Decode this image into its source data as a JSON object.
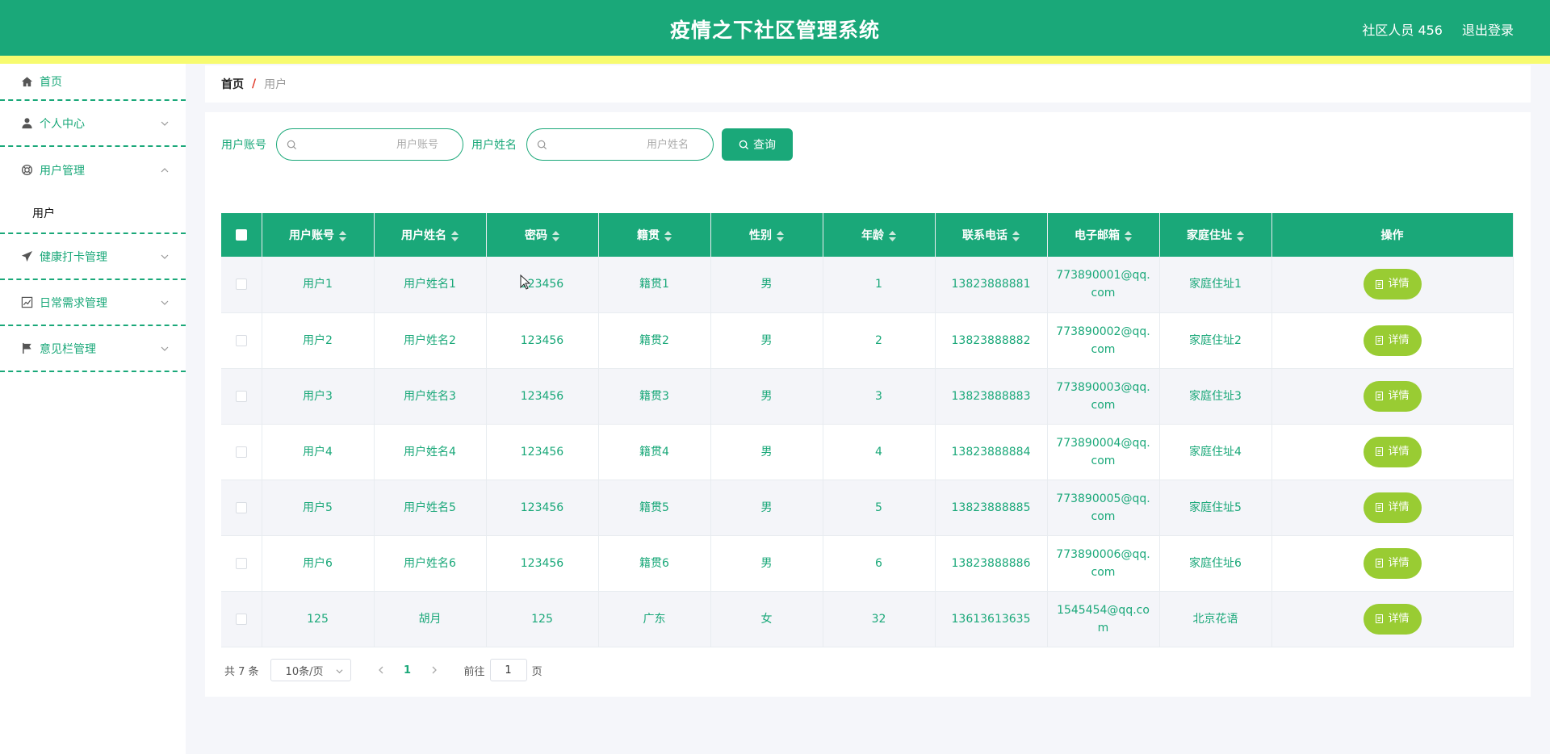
{
  "header": {
    "title": "疫情之下社区管理系统",
    "user": "社区人员 456",
    "logout": "退出登录"
  },
  "sidebar": {
    "items": [
      {
        "label": "首页",
        "icon": "home-icon"
      },
      {
        "label": "个人中心",
        "icon": "user-icon"
      },
      {
        "label": "用户管理",
        "icon": "lifebuoy-icon",
        "open": true,
        "children": [
          "用户"
        ]
      },
      {
        "label": "健康打卡管理",
        "icon": "send-icon"
      },
      {
        "label": "日常需求管理",
        "icon": "chart-icon"
      },
      {
        "label": "意见栏管理",
        "icon": "flag-icon"
      }
    ]
  },
  "breadcrumb": {
    "home": "首页",
    "separator": "/",
    "current": "用户"
  },
  "search": {
    "account_label": "用户账号",
    "account_placeholder": "用户账号",
    "name_label": "用户姓名",
    "name_placeholder": "用户姓名",
    "button": "查询"
  },
  "table": {
    "columns": [
      "用户账号",
      "用户姓名",
      "密码",
      "籍贯",
      "性别",
      "年龄",
      "联系电话",
      "电子邮箱",
      "家庭住址",
      "操作"
    ],
    "rows": [
      [
        "用户1",
        "用户姓名1",
        "123456",
        "籍贯1",
        "男",
        "1",
        "13823888881",
        "773890001@qq.com",
        "家庭住址1"
      ],
      [
        "用户2",
        "用户姓名2",
        "123456",
        "籍贯2",
        "男",
        "2",
        "13823888882",
        "773890002@qq.com",
        "家庭住址2"
      ],
      [
        "用户3",
        "用户姓名3",
        "123456",
        "籍贯3",
        "男",
        "3",
        "13823888883",
        "773890003@qq.com",
        "家庭住址3"
      ],
      [
        "用户4",
        "用户姓名4",
        "123456",
        "籍贯4",
        "男",
        "4",
        "13823888884",
        "773890004@qq.com",
        "家庭住址4"
      ],
      [
        "用户5",
        "用户姓名5",
        "123456",
        "籍贯5",
        "男",
        "5",
        "13823888885",
        "773890005@qq.com",
        "家庭住址5"
      ],
      [
        "用户6",
        "用户姓名6",
        "123456",
        "籍贯6",
        "男",
        "6",
        "13823888886",
        "773890006@qq.com",
        "家庭住址6"
      ],
      [
        "125",
        "胡月",
        "125",
        "广东",
        "女",
        "32",
        "13613613635",
        "1545454@qq.com",
        "北京花语"
      ]
    ],
    "action_label": "详情"
  },
  "pagination": {
    "total": "共 7 条",
    "page_size": "10条/页",
    "current_page": "1",
    "goto_label": "前往",
    "goto_value": "1",
    "page_suffix": "页"
  },
  "colors": {
    "primary": "#1aa879",
    "accent_stripe": "#f7fb6f",
    "action": "#99cc33",
    "separator": "#e03a2a"
  }
}
